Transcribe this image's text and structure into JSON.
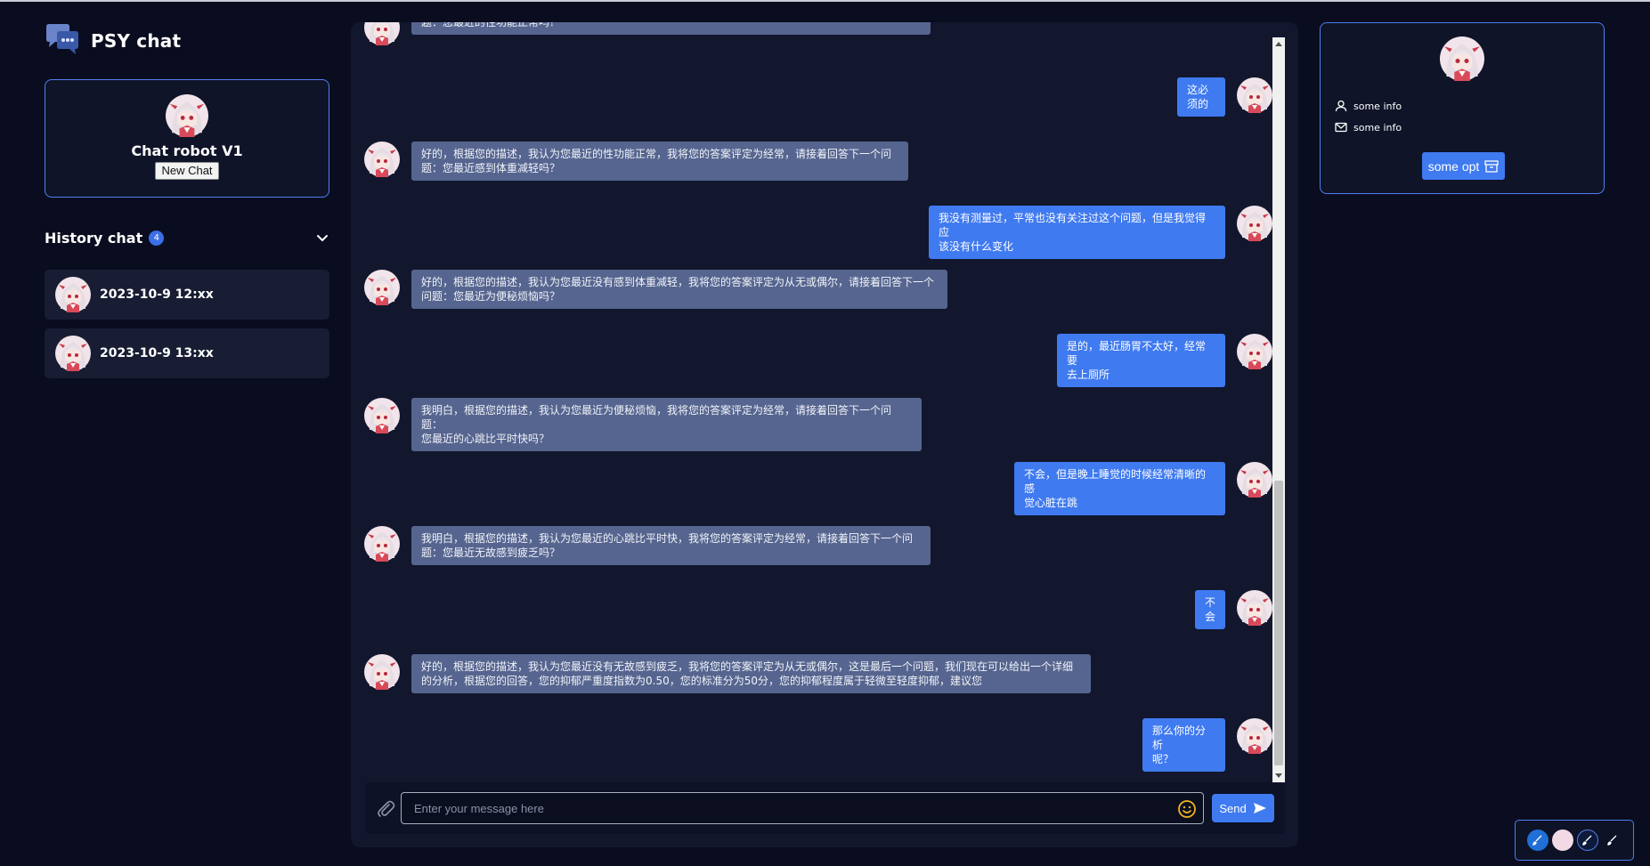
{
  "app": {
    "title": "PSY chat",
    "accent": "#3f7af0",
    "background": "#0a0d1f",
    "logo_icon": "chat-bubbles-icon"
  },
  "bot_card": {
    "name": "Chat robot V1",
    "new_chat_label": "New Chat"
  },
  "history": {
    "title": "History chat",
    "count": "4",
    "items": [
      {
        "label": "2023-10-9 12:xx"
      },
      {
        "label": "2023-10-9 13:xx"
      }
    ]
  },
  "messages": [
    {
      "role": "bot",
      "text": "题：您最近的性功能正常吗？"
    },
    {
      "role": "user",
      "text": "这必\n须的"
    },
    {
      "role": "bot",
      "text": "好的，根据您的描述，我认为您最近的性功能正常，我将您的答案评定为经常，请接着回答下一个问\n题：您最近感到体重减轻吗？"
    },
    {
      "role": "user",
      "text": "我没有测量过，平常也没有关注过这个问题，但是我觉得应\n该没有什么变化"
    },
    {
      "role": "bot",
      "text": "好的，根据您的描述，我认为您最近没有感到体重减轻，我将您的答案评定为从无或偶尔，请接着回答下一个\n问题：您最近为便秘烦恼吗？"
    },
    {
      "role": "user",
      "text": "是的，最近肠胃不太好，经常要\n去上厕所"
    },
    {
      "role": "bot",
      "text": "我明白，根据您的描述，我认为您最近为便秘烦恼，我将您的答案评定为经常，请接着回答下一个问题：\n您最近的心跳比平时快吗？"
    },
    {
      "role": "user",
      "text": "不会，但是晚上睡觉的时候经常清晰的感\n觉心脏在跳"
    },
    {
      "role": "bot",
      "text": "我明白，根据您的描述，我认为您最近的心跳比平时快，我将您的答案评定为经常，请接着回答下一个问\n题：您最近无故感到疲乏吗？"
    },
    {
      "role": "user",
      "text": "不\n会"
    },
    {
      "role": "bot",
      "text": "好的，根据您的描述，我认为您最近没有无故感到疲乏，我将您的答案评定为从无或偶尔，这是最后一个问题，我们现在可以给出一个详细\n的分析，根据您的回答，您的抑郁严重度指数为0.50，您的标准分为50分，您的抑郁程度属于轻微至轻度抑郁，建议您"
    },
    {
      "role": "user",
      "text": "那么你的分析\n呢？"
    }
  ],
  "composer": {
    "placeholder": "Enter your message here",
    "send_label": "Send"
  },
  "profile": {
    "info": [
      {
        "icon": "user-icon",
        "text": "some info"
      },
      {
        "icon": "mail-icon",
        "text": "some info"
      }
    ],
    "opt_label": "some opt"
  },
  "theme_bar": {
    "swatches": [
      {
        "color": "#1f6fd6"
      },
      {
        "color": "#f2d9e6"
      },
      {
        "color": "#0d1a3a"
      },
      {
        "color": "#ffffff"
      }
    ]
  }
}
